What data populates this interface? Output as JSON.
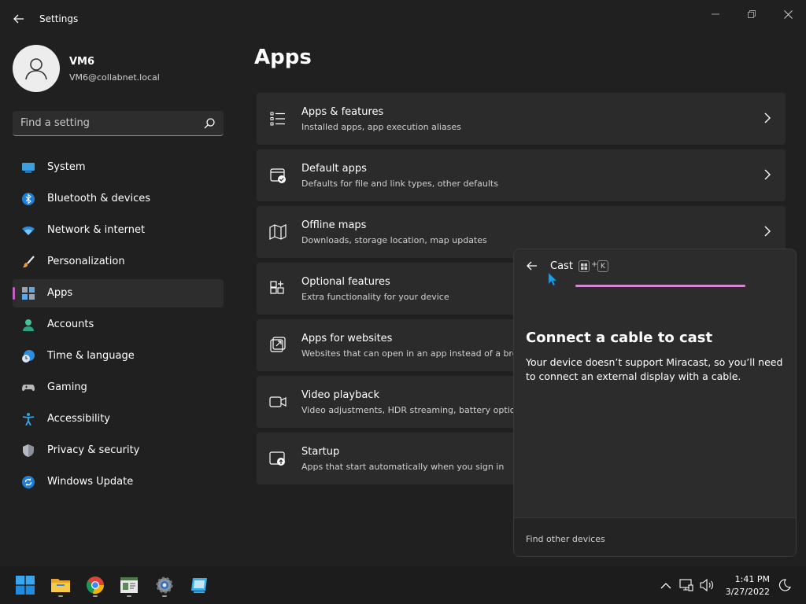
{
  "window": {
    "title": "Settings",
    "controls": {
      "minimize": "minimize-icon",
      "maximize": "maximize-icon",
      "close": "close-icon"
    }
  },
  "profile": {
    "name": "VM6",
    "email": "VM6@collabnet.local"
  },
  "search": {
    "placeholder": "Find a setting"
  },
  "sidebar": {
    "items": [
      {
        "label": "System",
        "icon": "system-icon",
        "selected": false
      },
      {
        "label": "Bluetooth & devices",
        "icon": "bluetooth-icon",
        "selected": false
      },
      {
        "label": "Network & internet",
        "icon": "network-icon",
        "selected": false
      },
      {
        "label": "Personalization",
        "icon": "brush-icon",
        "selected": false
      },
      {
        "label": "Apps",
        "icon": "apps-icon",
        "selected": true
      },
      {
        "label": "Accounts",
        "icon": "accounts-icon",
        "selected": false
      },
      {
        "label": "Time & language",
        "icon": "clock-globe-icon",
        "selected": false
      },
      {
        "label": "Gaming",
        "icon": "gamepad-icon",
        "selected": false
      },
      {
        "label": "Accessibility",
        "icon": "accessibility-icon",
        "selected": false
      },
      {
        "label": "Privacy & security",
        "icon": "shield-icon",
        "selected": false
      },
      {
        "label": "Windows Update",
        "icon": "update-icon",
        "selected": false
      }
    ]
  },
  "main": {
    "title": "Apps",
    "cards": [
      {
        "title": "Apps & features",
        "subtitle": "Installed apps, app execution aliases",
        "icon": "list-icon"
      },
      {
        "title": "Default apps",
        "subtitle": "Defaults for file and link types, other defaults",
        "icon": "default-apps-icon"
      },
      {
        "title": "Offline maps",
        "subtitle": "Downloads, storage location, map updates",
        "icon": "map-icon"
      },
      {
        "title": "Optional features",
        "subtitle": "Extra functionality for your device",
        "icon": "add-grid-icon"
      },
      {
        "title": "Apps for websites",
        "subtitle": "Websites that can open in an app instead of a bro",
        "icon": "open-external-icon"
      },
      {
        "title": "Video playback",
        "subtitle": "Video adjustments, HDR streaming, battery option",
        "icon": "video-icon"
      },
      {
        "title": "Startup",
        "subtitle": "Apps that start automatically when you sign in",
        "icon": "startup-icon"
      }
    ]
  },
  "cast": {
    "title": "Cast",
    "shortcut_plus": "+",
    "shortcut_key": "K",
    "heading": "Connect a cable to cast",
    "message": "Your device doesn’t support Miracast, so you’ll need to connect an external display with a cable.",
    "footer_link": "Find other devices",
    "progress_fraction": 1.0
  },
  "taskbar": {
    "apps": [
      "start-icon",
      "file-explorer-icon",
      "chrome-icon",
      "app-window-icon",
      "settings-icon",
      "remote-icon"
    ],
    "tray": [
      "chevron-up-icon",
      "network-display-icon",
      "volume-icon",
      "night-icon"
    ],
    "time": "1:41 PM",
    "date": "3/27/2022"
  },
  "colors": {
    "accent": "#c65cc6",
    "background": "#202020",
    "card": "#2b2b2b"
  }
}
